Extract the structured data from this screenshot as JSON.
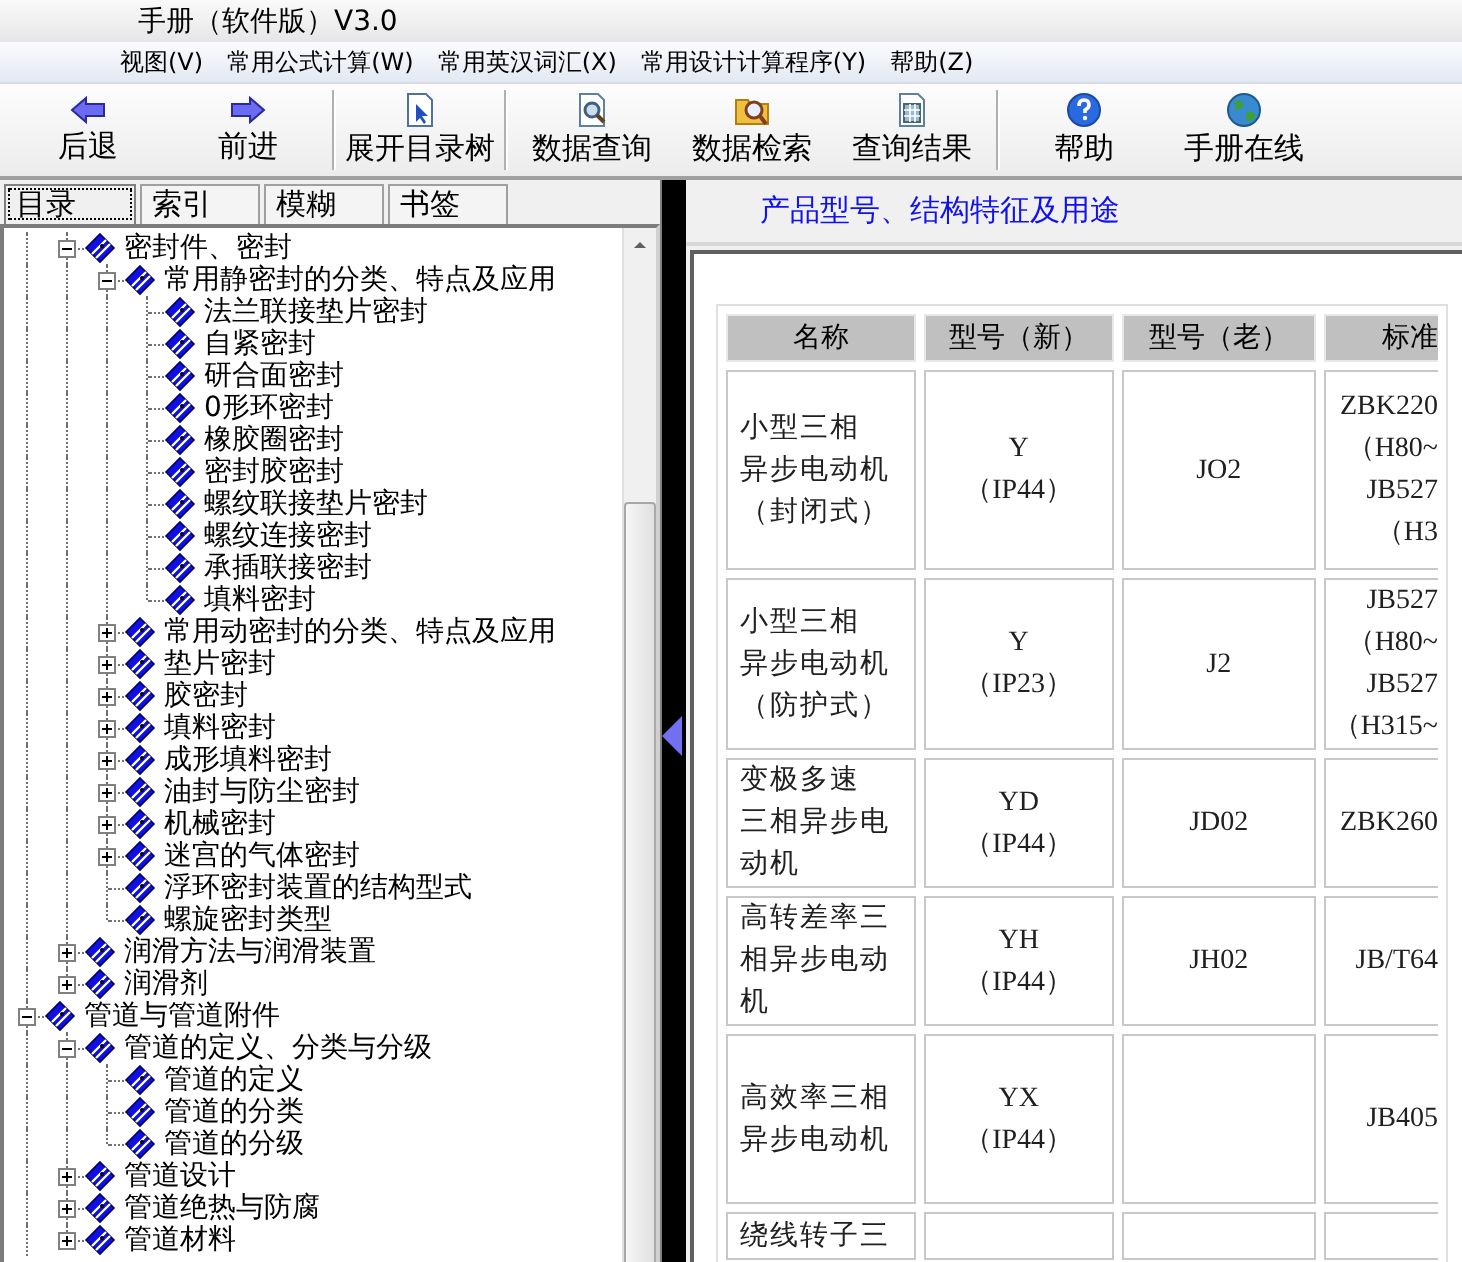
{
  "window": {
    "title": "手册（软件版）V3.0"
  },
  "menu": [
    "视图(V)",
    "常用公式计算(W)",
    "常用英汉词汇(X)",
    "常用设计计算程序(Y)",
    "帮助(Z)"
  ],
  "toolbar": [
    [
      {
        "kind": "back",
        "label": "后退"
      },
      {
        "kind": "forward",
        "label": "前进"
      }
    ],
    [
      {
        "kind": "expand",
        "label": "展开目录树"
      }
    ],
    [
      {
        "kind": "query",
        "label": "数据查询"
      },
      {
        "kind": "search",
        "label": "数据检索"
      },
      {
        "kind": "results",
        "label": "查询结果"
      }
    ],
    [
      {
        "kind": "help",
        "label": "帮助"
      },
      {
        "kind": "online",
        "label": "手册在线"
      }
    ]
  ],
  "sidebar": {
    "tabs": [
      {
        "label": "目录",
        "selected": true
      },
      {
        "label": "索引",
        "selected": false
      },
      {
        "label": "模糊",
        "selected": false
      },
      {
        "label": "书签",
        "selected": false
      }
    ],
    "tree": [
      {
        "children": [
          {
            "label": "密封件、密封",
            "expanded": true,
            "children": [
              {
                "label": "常用静密封的分类、特点及应用",
                "expanded": true,
                "children": [
                  {
                    "label": "法兰联接垫片密封"
                  },
                  {
                    "label": "自紧密封"
                  },
                  {
                    "label": "研合面密封"
                  },
                  {
                    "label": "0形环密封"
                  },
                  {
                    "label": "橡胶圈密封"
                  },
                  {
                    "label": "密封胶密封"
                  },
                  {
                    "label": "螺纹联接垫片密封"
                  },
                  {
                    "label": "螺纹连接密封"
                  },
                  {
                    "label": "承插联接密封"
                  },
                  {
                    "label": "填料密封"
                  }
                ]
              },
              {
                "label": "常用动密封的分类、特点及应用",
                "expanded": false
              },
              {
                "label": "垫片密封",
                "expanded": false
              },
              {
                "label": "胶密封",
                "expanded": false
              },
              {
                "label": "填料密封",
                "expanded": false
              },
              {
                "label": "成形填料密封",
                "expanded": false
              },
              {
                "label": "油封与防尘密封",
                "expanded": false
              },
              {
                "label": "机械密封",
                "expanded": false
              },
              {
                "label": "迷宫的气体密封",
                "expanded": false
              },
              {
                "label": "浮环密封装置的结构型式"
              },
              {
                "label": "螺旋密封类型"
              }
            ]
          },
          {
            "label": "润滑方法与润滑装置",
            "expanded": false
          },
          {
            "label": "润滑剂",
            "expanded": false
          }
        ]
      },
      {
        "label": "管道与管道附件",
        "expanded": true,
        "children": [
          {
            "label": "管道的定义、分类与分级",
            "expanded": true,
            "children": [
              {
                "label": "管道的定义"
              },
              {
                "label": "管道的分类"
              },
              {
                "label": "管道的分级"
              }
            ]
          },
          {
            "label": "管道设计",
            "expanded": false
          },
          {
            "label": "管道绝热与防腐",
            "expanded": false
          },
          {
            "label": "管道材料",
            "expanded": false
          }
        ]
      }
    ]
  },
  "content": {
    "heading": "产品型号、结构特征及用途",
    "table": {
      "columns": [
        "名称",
        "型号（新）",
        "型号（老）",
        "标准"
      ],
      "rows": [
        {
          "name": [
            "小型三相",
            "异步电动机",
            "（封闭式）"
          ],
          "model_new": [
            "Y",
            "（IP44）"
          ],
          "model_old": [
            "JO2"
          ],
          "standard": [
            "ZBK220",
            "（H80~",
            "JB527",
            "（H3"
          ]
        },
        {
          "name": [
            "小型三相",
            "异步电动机",
            "（防护式）"
          ],
          "model_new": [
            "Y",
            "（IP23）"
          ],
          "model_old": [
            "J2"
          ],
          "standard": [
            "JB527",
            "（H80~",
            "JB527",
            "（H315~"
          ]
        },
        {
          "name": [
            "变极多速",
            "三相异步电",
            "动机"
          ],
          "model_new": [
            "YD",
            "（IP44）"
          ],
          "model_old": [
            "JD02"
          ],
          "standard": [
            "ZBK260"
          ]
        },
        {
          "name": [
            "高转差率三",
            "相异步电动",
            "机"
          ],
          "model_new": [
            "YH",
            "（IP44）"
          ],
          "model_old": [
            "JH02"
          ],
          "standard": [
            "JB/T64"
          ]
        },
        {
          "name": [
            "高效率三相",
            "异步电动机"
          ],
          "model_new": [
            "YX",
            "（IP44）"
          ],
          "standard": [
            "JB405"
          ]
        },
        {
          "name": [
            "绕线转子三"
          ]
        }
      ]
    }
  }
}
